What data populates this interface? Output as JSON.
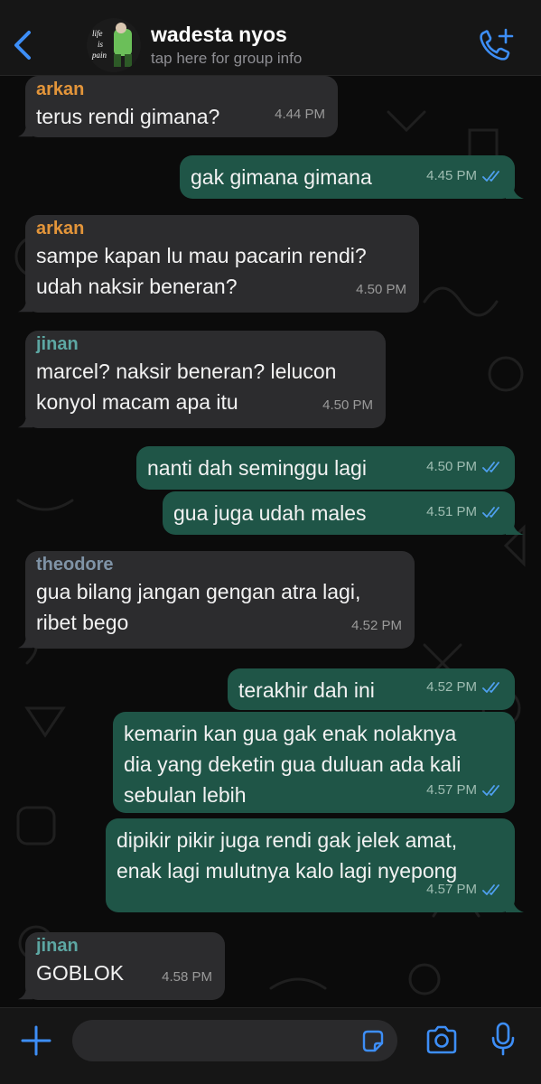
{
  "header": {
    "title": "wadesta nyos",
    "subtitle": "tap here for group info",
    "avatar_text": [
      "life",
      "is",
      "pain"
    ]
  },
  "colors": {
    "accent": "#3d8ef7",
    "incoming_bubble": "#2c2c2e",
    "outgoing_bubble": "#1f5547",
    "arkan": "#e3953a",
    "jinan": "#5da7a3",
    "theodore": "#7f93a6",
    "read_ticks": "#4fa0f0"
  },
  "messages": [
    {
      "dir": "in",
      "sender": "arkan",
      "text": "terus rendi gimana?",
      "time": "4.44 PM"
    },
    {
      "dir": "out",
      "text": "gak gimana gimana",
      "time": "4.45 PM"
    },
    {
      "dir": "in",
      "sender": "arkan",
      "text": "sampe kapan lu mau pacarin rendi?\nudah naksir beneran?",
      "time": "4.50 PM"
    },
    {
      "dir": "in",
      "sender": "jinan",
      "text": "marcel? naksir beneran? lelucon\nkonyol macam apa itu",
      "time": "4.50 PM"
    },
    {
      "dir": "out",
      "text": "nanti dah seminggu lagi",
      "time": "4.50 PM"
    },
    {
      "dir": "out",
      "text": "gua juga udah males",
      "time": "4.51 PM"
    },
    {
      "dir": "in",
      "sender": "theodore",
      "text": "gua bilang jangan gengan atra lagi,\nribet bego",
      "time": "4.52 PM"
    },
    {
      "dir": "out",
      "text": "terakhir dah ini",
      "time": "4.52 PM"
    },
    {
      "dir": "out",
      "text": "kemarin kan gua gak enak nolaknya\ndia yang deketin gua duluan ada kali\nsebulan lebih",
      "time": "4.57 PM"
    },
    {
      "dir": "out",
      "text": "dipikir pikir juga rendi gak jelek amat,\nenak lagi mulutnya kalo lagi nyepong",
      "time": "4.57 PM"
    },
    {
      "dir": "in",
      "sender": "jinan",
      "text": "GOBLOK",
      "time": "4.58 PM"
    }
  ],
  "input": {
    "placeholder": "",
    "value": ""
  },
  "icons": {
    "back": "chevron-left-icon",
    "call": "phone-add-icon",
    "attach": "plus-icon",
    "sticker": "sticker-icon",
    "camera": "camera-icon",
    "mic": "microphone-icon",
    "ticks": "double-check-icon"
  }
}
